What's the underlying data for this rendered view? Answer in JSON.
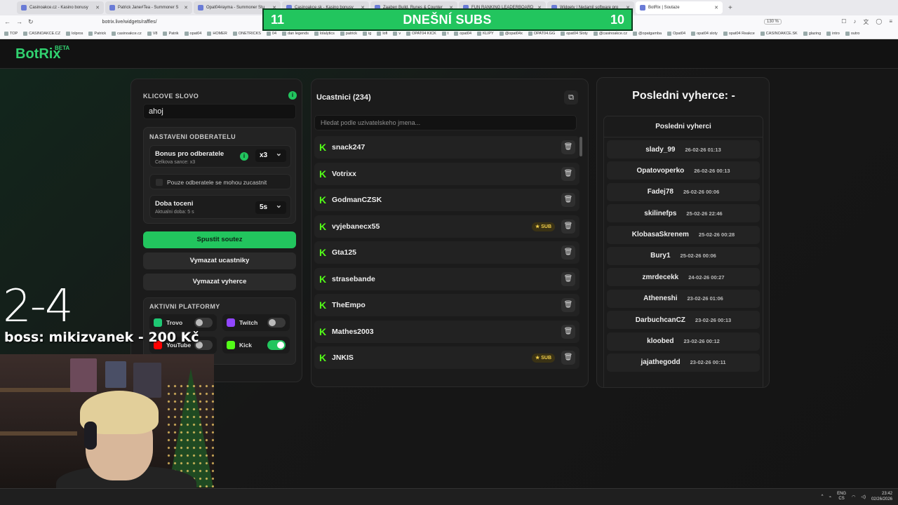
{
  "browser": {
    "tabs": [
      "Casinoakce.cz - Kasino bonusy",
      "Patrick Jane#Tea - Summoner S",
      "Opat04#ayma - Summoner Stu",
      "Casinoakce.sk - Kasino bonusy",
      "Zaaben Build, Runes & Counter",
      "FUN RANKING LEADERBOARD",
      "Widgety | Nedamil software pro",
      "BotRix | Soutaze"
    ],
    "url": "botrix.live/widgets/raffles/",
    "zoom": "130 %",
    "bookmarks": [
      "TOP",
      "CASINOAKCE.CZ",
      "lolpros",
      "Patrick",
      "casinoakce.cz",
      "V8",
      "Patrik",
      "opat04",
      "HOMER",
      "ONETRICKS",
      "04",
      "dan legends",
      "lolalytics",
      "patrick",
      "ig",
      "lofi",
      "v",
      "OPAT04 KICK",
      "t",
      "opat04",
      "KLIPY",
      "@opat04x",
      "OPAT04.GG",
      "opat04 Sloty",
      "@casinoakce.cz",
      "@opatgamba",
      "Opat04",
      "opat04 sloty",
      "opat04 Reakce",
      "CASINOAKCE.SK",
      "glazing",
      "intro",
      "outro"
    ]
  },
  "overlay": {
    "subs_left": "11",
    "subs_title": "DNEŠNÍ SUBS",
    "subs_right": "10",
    "score": "2-4",
    "boss": "boss:  mikizvanek - 200 Kč"
  },
  "app": {
    "logo": "BotRix",
    "logo_badge": "BETA"
  },
  "settings": {
    "keyword_label": "KLICOVE SLOVO",
    "keyword_value": "ahoj",
    "subscriber_section": "NASTAVENI ODBERATELU",
    "bonus_title": "Bonus pro odberatele",
    "bonus_sub": "Celkova sance: x3",
    "bonus_value": "x3",
    "only_subs_label": "Pouze odberatele se mohou zucastnit",
    "spin_title": "Doba toceni",
    "spin_sub": "Aktualni doba: 5 s",
    "spin_value": "5s",
    "start_button": "Spustit soutez",
    "clear_participants_button": "Vymazat ucastniky",
    "clear_winners_button": "Vymazat vyherce",
    "platforms_label": "AKTIVNI PLATFORMY",
    "platforms": [
      {
        "name": "Trovo",
        "enabled": false,
        "color": "#1ec773"
      },
      {
        "name": "Twitch",
        "enabled": false,
        "color": "#9146ff"
      },
      {
        "name": "YouTube",
        "enabled": false,
        "color": "#ff0000"
      },
      {
        "name": "Kick",
        "enabled": true,
        "color": "#53fc18"
      }
    ]
  },
  "participants": {
    "title": "Ucastnici (234)",
    "search_placeholder": "Hledat podle uzivatelskeho jmena...",
    "sub_badge": "★ SUB",
    "list": [
      {
        "name": "snack247",
        "sub": false
      },
      {
        "name": "Votrixx",
        "sub": false
      },
      {
        "name": "GodmanCZSK",
        "sub": false
      },
      {
        "name": "vyjebanecx55",
        "sub": true
      },
      {
        "name": "Gta125",
        "sub": false
      },
      {
        "name": "strasebande",
        "sub": false
      },
      {
        "name": "TheEmpo",
        "sub": false
      },
      {
        "name": "Mathes2003",
        "sub": false
      },
      {
        "name": "JNKIS",
        "sub": true
      }
    ]
  },
  "winners": {
    "last_winner_title": "Posledni vyherce: -",
    "list_title": "Posledni vyherci",
    "list": [
      {
        "name": "slady_99",
        "date": "26-02-26 01:13"
      },
      {
        "name": "Opatovoperko",
        "date": "26-02-26 00:13"
      },
      {
        "name": "Fadej78",
        "date": "26-02-26 00:06"
      },
      {
        "name": "skilinefps",
        "date": "25-02-26 22:46"
      },
      {
        "name": "KlobasaSkrenem",
        "date": "25-02-26 00:28"
      },
      {
        "name": "Bury1",
        "date": "25-02-26 00:06"
      },
      {
        "name": "zmrdecekk",
        "date": "24-02-26 00:27"
      },
      {
        "name": "Atheneshi",
        "date": "23-02-26 01:06"
      },
      {
        "name": "DarbuchcanCZ",
        "date": "23-02-26 00:13"
      },
      {
        "name": "kloobed",
        "date": "23-02-26 00:12"
      },
      {
        "name": "jajathegodd",
        "date": "23-02-26 00:11"
      }
    ]
  },
  "taskbar": {
    "lang": "ENG",
    "lang_sub": "CS",
    "time": "23:42",
    "date": "02/26/2026"
  }
}
